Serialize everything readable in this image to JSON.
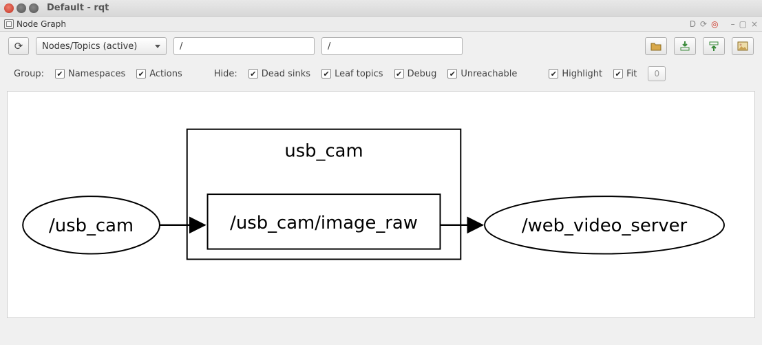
{
  "window": {
    "title": "Default - rqt"
  },
  "plugin": {
    "title": "Node Graph",
    "right_icons": [
      "D-icon",
      "refresh-mini-icon",
      "target-icon"
    ],
    "window_controls": [
      "minimize",
      "restore",
      "close"
    ]
  },
  "toolbar": {
    "refresh_glyph": "⟳",
    "view_selector": "Nodes/Topics (active)",
    "node_filter": "/",
    "topic_filter": "/",
    "right_buttons": [
      "open-folder",
      "expand-down",
      "expand-up",
      "image-export"
    ]
  },
  "options": {
    "group_label": "Group:",
    "hide_label": "Hide:",
    "group": {
      "namespaces": "Namespaces",
      "actions": "Actions"
    },
    "hide": {
      "dead_sinks": "Dead sinks",
      "leaf_topics": "Leaf topics",
      "debug": "Debug",
      "unreachable": "Unreachable"
    },
    "highlight": "Highlight",
    "fit": "Fit",
    "depth": "0"
  },
  "graph": {
    "namespace_label": "usb_cam",
    "node_a": "/usb_cam",
    "topic": "/usb_cam/image_raw",
    "node_b": "/web_video_server"
  }
}
